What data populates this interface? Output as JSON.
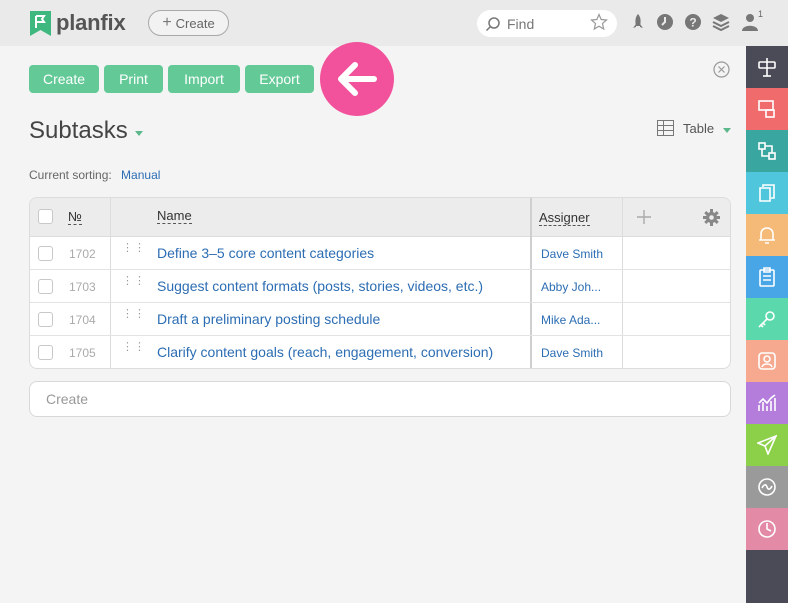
{
  "app": {
    "name": "planfix"
  },
  "topbar": {
    "create_label": "Create",
    "search_placeholder": "Find",
    "notification_count": "1"
  },
  "toolbar": {
    "create_label": "Create",
    "print_label": "Print",
    "import_label": "Import",
    "export_label": "Export"
  },
  "page": {
    "title": "Subtasks",
    "view_label": "Table",
    "sorting_label": "Current sorting:",
    "sorting_value": "Manual"
  },
  "table": {
    "columns": {
      "number": "№",
      "name": "Name",
      "assigner": "Assigner"
    },
    "rows": [
      {
        "number": "1702",
        "name": "Define 3–5 core content categories",
        "assigner": "Dave Smith"
      },
      {
        "number": "1703",
        "name": "Suggest content formats (posts, stories, videos, etc.)",
        "assigner": "Abby Joh..."
      },
      {
        "number": "1704",
        "name": "Draft a preliminary posting schedule",
        "assigner": "Mike Ada..."
      },
      {
        "number": "1705",
        "name": "Clarify content goals (reach, engagement, conversion)",
        "assigner": "Dave Smith"
      }
    ]
  },
  "create_input": {
    "placeholder": "Create"
  },
  "colors": {
    "accent_green": "#63c997",
    "highlight_pink": "#f1529b",
    "link_blue": "#2c6db3",
    "sidebar_items": [
      "#4b4b57",
      "#f06b6b",
      "#3aa6a0",
      "#4fc6dc",
      "#f5b978",
      "#48a5e6",
      "#5bd9ac",
      "#f6a98e",
      "#b47ddc",
      "#8cd04a",
      "#9a9a9a",
      "#e38aa6"
    ]
  },
  "sidebar_icons": [
    "sign-icon",
    "tasks-icon",
    "process-icon",
    "documents-icon",
    "bell-icon",
    "clipboard-icon",
    "key-icon",
    "contacts-icon",
    "analytics-icon",
    "send-icon",
    "activity-icon",
    "clock-icon"
  ]
}
